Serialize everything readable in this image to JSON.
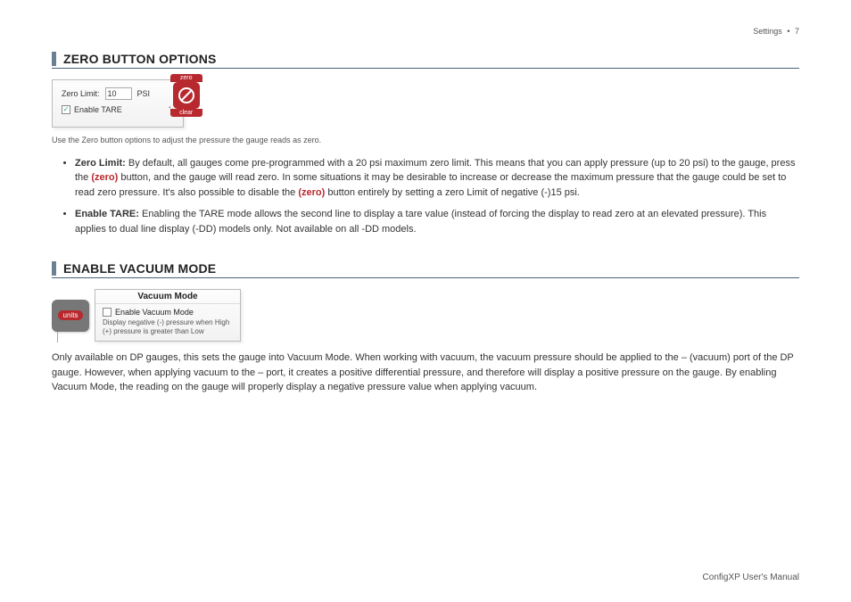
{
  "header": {
    "section": "Settings",
    "page": "7"
  },
  "s1": {
    "title": "ZERO BUTTON OPTIONS",
    "panel": {
      "zero_limit_label": "Zero Limit:",
      "zero_limit_value": "10",
      "zero_limit_unit": "PSI",
      "enable_tare_label": "Enable TARE",
      "enable_tare_checked": "✓"
    },
    "badge": {
      "top": "zero",
      "bottom": "clear"
    },
    "caption": "Use the Zero button options to adjust the pressure the gauge reads as zero.",
    "bullets": {
      "b1_strong": "Zero Limit:",
      "b1_a": " By default, all gauges come pre-programmed with a 20 psi maximum zero limit. This means that you can apply pressure (up to 20 psi) to the gauge, press the ",
      "b1_zero": "zero",
      "b1_b": " button, and the gauge will read zero. In some situations it may be desirable to increase or decrease the maximum pressure that the gauge could be set to read zero pressure. It's also possible to disable the ",
      "b1_zero2": "zero",
      "b1_c": " button entirely by setting a zero Limit of negative (-)15 psi.",
      "b2_strong": "Enable TARE:",
      "b2": " Enabling the TARE mode allows the second line to display a tare value (instead of forcing the display to read zero at an elevated pressure). This applies to dual line display (-DD) models only. Not available on all -DD models."
    }
  },
  "s2": {
    "title": "ENABLE VACUUM MODE",
    "units_label": "units",
    "panel": {
      "header": "Vacuum Mode",
      "enable_label": "Enable Vacuum Mode",
      "note": "Display negative (-) pressure when High (+) pressure is greater than Low"
    },
    "para": "Only available on DP gauges, this sets the gauge into Vacuum Mode. When working with vacuum, the vacuum pressure should be applied to the – (vacuum) port of the DP gauge. However, when applying vacuum to the – port, it creates a positive differential pressure, and therefore will display a positive pressure on the gauge. By enabling Vacuum Mode, the reading on the gauge will properly display a negative pressure value when applying vacuum."
  },
  "footer": "ConfigXP User's Manual"
}
